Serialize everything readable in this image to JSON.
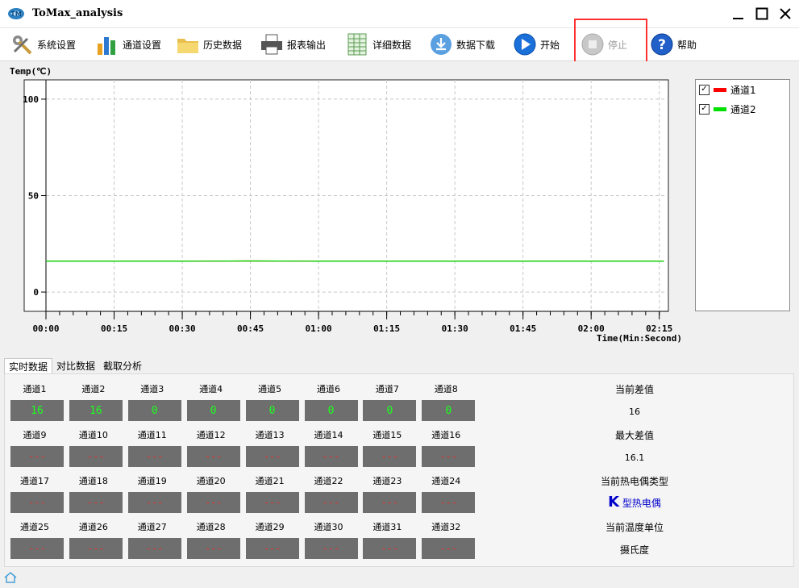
{
  "window": {
    "title": "ToMax_analysis"
  },
  "toolbar": {
    "items": [
      {
        "label": "系统设置",
        "icon": "settings-tools-icon"
      },
      {
        "label": "通道设置",
        "icon": "bar-chart-icon"
      },
      {
        "label": "历史数据",
        "icon": "folder-icon"
      },
      {
        "label": "报表输出",
        "icon": "printer-icon"
      },
      {
        "label": "详细数据",
        "icon": "spreadsheet-icon"
      },
      {
        "label": "数据下载",
        "icon": "download-icon"
      },
      {
        "label": "开始",
        "icon": "play-icon"
      },
      {
        "label": "停止",
        "icon": "stop-icon",
        "disabled": true
      },
      {
        "label": "帮助",
        "icon": "help-icon"
      }
    ]
  },
  "chart_data": {
    "type": "line",
    "ylabel": "Temp(℃)",
    "xlabel": "Time(Min:Second)",
    "ylim": [
      -10,
      110
    ],
    "yticks": [
      0,
      50,
      100
    ],
    "xlim": [
      0,
      137
    ],
    "xticks": [
      "00:00",
      "00:15",
      "00:30",
      "00:45",
      "01:00",
      "01:15",
      "01:30",
      "01:45",
      "02:00",
      "02:15"
    ],
    "grid": true,
    "series": [
      {
        "name": "通道1",
        "color": "#ff0000",
        "x": [
          0,
          15,
          30,
          45,
          60,
          75,
          90,
          105,
          120,
          136
        ],
        "y": [
          16,
          16,
          16,
          16.1,
          16,
          16,
          16,
          16,
          16,
          16
        ]
      },
      {
        "name": "通道2",
        "color": "#00e000",
        "x": [
          0,
          15,
          30,
          45,
          60,
          75,
          90,
          105,
          120,
          136
        ],
        "y": [
          16,
          16,
          16,
          16.1,
          16,
          16,
          16,
          16,
          16,
          16
        ]
      }
    ]
  },
  "legend": {
    "items": [
      {
        "label": "通道1",
        "color": "#ff0000",
        "checked": true
      },
      {
        "label": "通道2",
        "color": "#00e000",
        "checked": true
      }
    ]
  },
  "tabs": [
    "实时数据",
    "对比数据",
    "截取分析"
  ],
  "channels": [
    {
      "label": "通道1",
      "value": "16"
    },
    {
      "label": "通道2",
      "value": "16"
    },
    {
      "label": "通道3",
      "value": "0"
    },
    {
      "label": "通道4",
      "value": "0"
    },
    {
      "label": "通道5",
      "value": "0"
    },
    {
      "label": "通道6",
      "value": "0"
    },
    {
      "label": "通道7",
      "value": "0"
    },
    {
      "label": "通道8",
      "value": "0"
    },
    {
      "label": "通道9",
      "value": "---"
    },
    {
      "label": "通道10",
      "value": "---"
    },
    {
      "label": "通道11",
      "value": "---"
    },
    {
      "label": "通道12",
      "value": "---"
    },
    {
      "label": "通道13",
      "value": "---"
    },
    {
      "label": "通道14",
      "value": "---"
    },
    {
      "label": "通道15",
      "value": "---"
    },
    {
      "label": "通道16",
      "value": "---"
    },
    {
      "label": "通道17",
      "value": "---"
    },
    {
      "label": "通道18",
      "value": "---"
    },
    {
      "label": "通道19",
      "value": "---"
    },
    {
      "label": "通道20",
      "value": "---"
    },
    {
      "label": "通道21",
      "value": "---"
    },
    {
      "label": "通道22",
      "value": "---"
    },
    {
      "label": "通道23",
      "value": "---"
    },
    {
      "label": "通道24",
      "value": "---"
    },
    {
      "label": "通道25",
      "value": "---"
    },
    {
      "label": "通道26",
      "value": "---"
    },
    {
      "label": "通道27",
      "value": "---"
    },
    {
      "label": "通道28",
      "value": "---"
    },
    {
      "label": "通道29",
      "value": "---"
    },
    {
      "label": "通道30",
      "value": "---"
    },
    {
      "label": "通道31",
      "value": "---"
    },
    {
      "label": "通道32",
      "value": "---"
    }
  ],
  "info": {
    "current_diff_label": "当前差值",
    "current_diff_value": "16",
    "max_diff_label": "最大差值",
    "max_diff_value": "16.1",
    "tc_type_label": "当前热电偶类型",
    "tc_type_letter": "K",
    "tc_type_name": "型热电偶",
    "unit_label": "当前温度单位",
    "unit_value": "摄氏度"
  }
}
